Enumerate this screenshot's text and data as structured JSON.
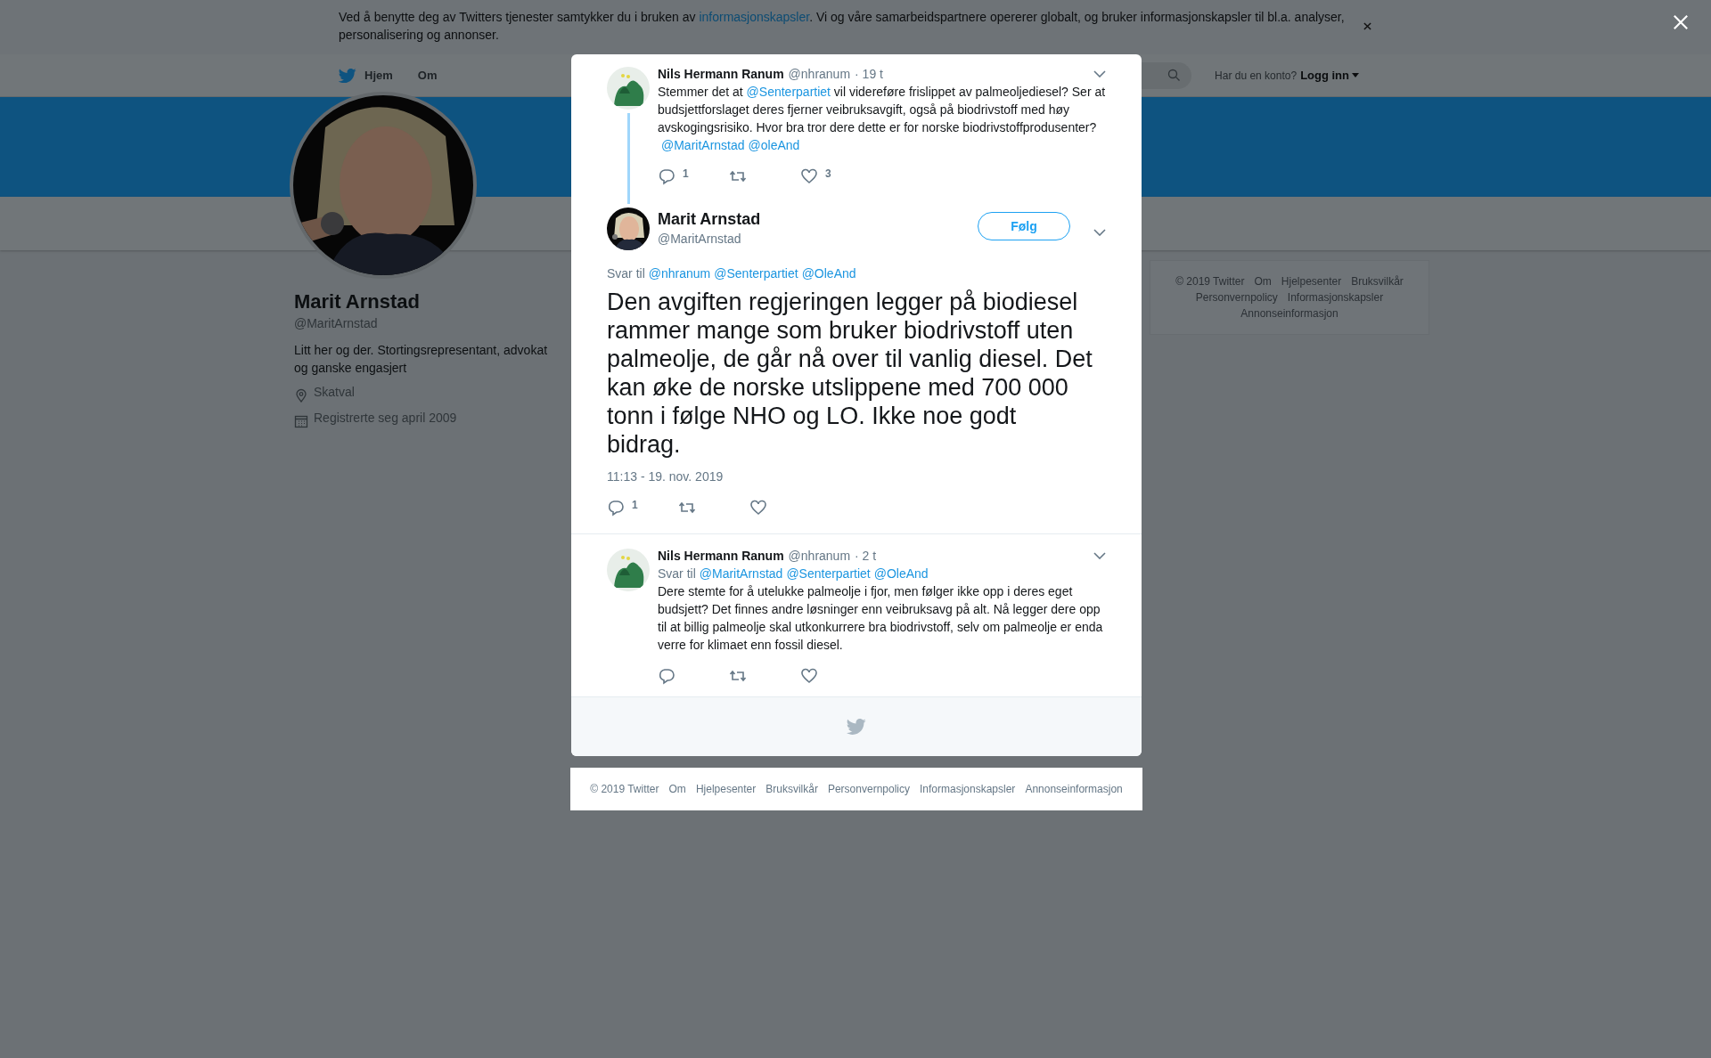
{
  "cookie_banner": {
    "text_before": "Ved å benytte deg av Twitters tjenester samtykker du i bruken av ",
    "link": "informasjonskapsler",
    "text_after": ". Vi og våre samarbeidspartnere opererer globalt, og bruker informasjonskapsler til bl.a. analyser, personalisering og annonser."
  },
  "nav": {
    "items": [
      {
        "label": "Hjem",
        "kind": "home"
      },
      {
        "label": "Om",
        "kind": "plain"
      }
    ],
    "login_prompt": "Har du en konto?",
    "login": "Logg inn"
  },
  "profile": {
    "name": "Marit Arnstad",
    "handle": "@MaritArnstad",
    "bio": "Litt her og der. Stortingsrepresentant, advokat og ganske engasjert",
    "location": "Skatval",
    "joined": "Registrerte seg april 2009"
  },
  "side_footer": [
    "© 2019 Twitter",
    "Om",
    "Hjelpesenter",
    "Bruksvilkår",
    "Personvernpolicy",
    "Informasjonskapsler",
    "Annonseinformasjon"
  ],
  "modal": {
    "parent_tweet": {
      "name": "Nils Hermann Ranum",
      "handle": "@nhranum",
      "time": "· 19 t",
      "text": [
        {
          "kind": "plain",
          "text": "Stemmer det at "
        },
        {
          "kind": "mention",
          "text": "@Senterpartiet"
        },
        {
          "kind": "plain",
          "text": " vil videreføre frislippet av palmeoljediesel? Ser at budsjettforslaget deres fjerner veibruksavgift, også på biodrivstoff med høy avskogingsrisiko. Hvor bra tror dere dette er for norske biodrivstoffprodusenter? "
        },
        {
          "kind": "mention",
          "text": "@MaritArnstad"
        },
        {
          "kind": "mention",
          "text": "@oleAnd"
        }
      ],
      "replies": "1",
      "likes": "3"
    },
    "main_tweet": {
      "name": "Marit Arnstad",
      "handle": "@MaritArnstad",
      "follow": "Følg",
      "reply_to_label": "Svar til",
      "reply_to": [
        "@nhranum",
        "@Senterpartiet",
        "@OleAnd"
      ],
      "text": "Den avgiften regjeringen legger på biodiesel rammer mange som bruker biodrivstoff uten palmeolje, de går nå over til vanlig diesel. Det kan øke de norske utslippene med 700 000 tonn i følge NHO og LO. Ikke noe godt bidrag.",
      "timestamp": "11:13 - 19. nov. 2019",
      "replies": "1"
    },
    "reply_tweet": {
      "name": "Nils Hermann Ranum",
      "handle": "@nhranum",
      "time": "· 2 t",
      "reply_to_label": "Svar til",
      "reply_to": [
        "@MaritArnstad",
        "@Senterpartiet",
        "@OleAnd"
      ],
      "text": "Dere stemte for å utelukke palmeolje i fjor, men følger ikke opp i deres eget budsjett? Det finnes andre løsninger enn veibruksavg på alt. Nå legger dere opp til at billig palmeolje skal utkonkurrere bra biodrivstoff, selv om palmeolje er enda verre for klimaet enn fossil diesel."
    }
  },
  "bottom_footer": [
    "© 2019 Twitter",
    "Om",
    "Hjelpesenter",
    "Bruksvilkår",
    "Personvernpolicy",
    "Informasjonskapsler",
    "Annonseinformasjon"
  ]
}
